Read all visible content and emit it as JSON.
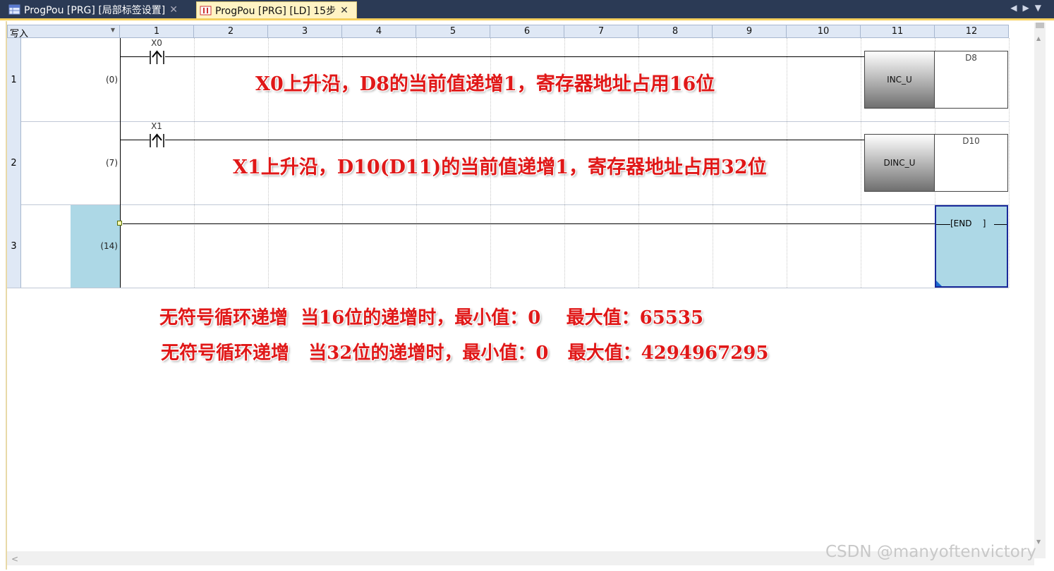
{
  "tabs": [
    {
      "label": "ProgPou [PRG] [局部标签设置]",
      "active": false
    },
    {
      "label": "ProgPou [PRG] [LD] 15步",
      "active": true
    }
  ],
  "header": {
    "write_mode": "写入",
    "columns": [
      "1",
      "2",
      "3",
      "4",
      "5",
      "6",
      "7",
      "8",
      "9",
      "10",
      "11",
      "12"
    ]
  },
  "rungs": [
    {
      "row": "1",
      "step": "(0)",
      "contact": "X0",
      "instruction": "INC_U",
      "operand": "D8"
    },
    {
      "row": "2",
      "step": "(7)",
      "contact": "X1",
      "instruction": "DINC_U",
      "operand": "D10"
    },
    {
      "row": "3",
      "step": "(14)",
      "end": "[END    ]"
    }
  ],
  "annotations": {
    "rung1": "X0上升沿，D8的当前值递增1，寄存器地址占用16位",
    "rung2": "X1上升沿，D10(D11)的当前值递增1，寄存器地址占用32位",
    "note1": "无符号循环递增  当16位的递增时，最小值：0    最大值：65535",
    "note2": "无符号循环递增   当32位的递增时，最小值：0   最大值：4294967295"
  },
  "watermark": "CSDN @manyoftenvictory",
  "colors": {
    "tabbar": "#2b3a55",
    "accent": "#f5cf5e",
    "selection": "#add8e6",
    "annotation": "#e01818"
  }
}
